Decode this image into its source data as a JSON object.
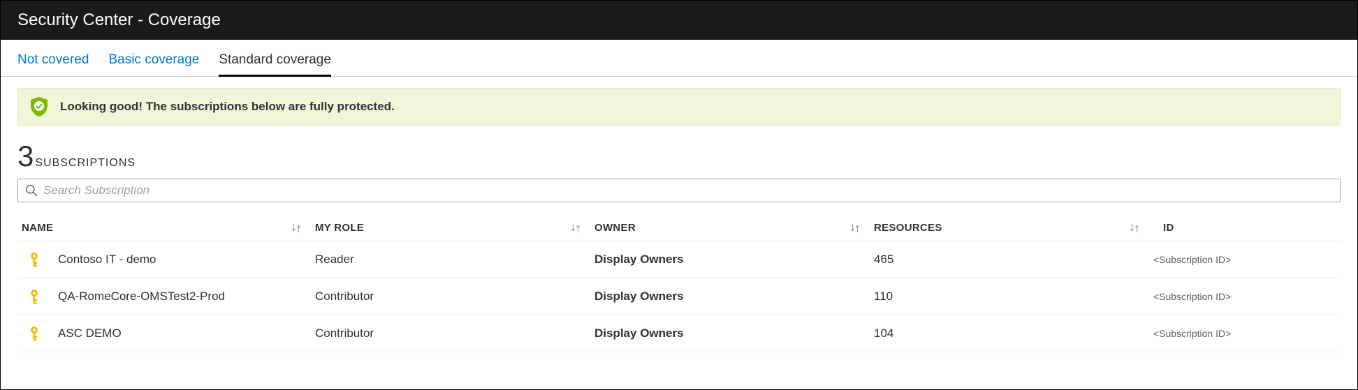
{
  "header": {
    "title": "Security Center - Coverage"
  },
  "tabs": [
    {
      "label": "Not covered",
      "active": false
    },
    {
      "label": "Basic coverage",
      "active": false
    },
    {
      "label": "Standard coverage",
      "active": true
    }
  ],
  "banner": {
    "text": "Looking good! The subscriptions below are fully protected."
  },
  "count": {
    "value": "3",
    "label": "SUBSCRIPTIONS"
  },
  "search": {
    "placeholder": "Search Subscription"
  },
  "columns": {
    "name": "NAME",
    "role": "MY ROLE",
    "owner": "OWNER",
    "resources": "RESOURCES",
    "id": "ID"
  },
  "rows": [
    {
      "name": "Contoso IT - demo",
      "role": "Reader",
      "owner": "Display Owners",
      "resources": "465",
      "id": "<Subscription ID>"
    },
    {
      "name": "QA-RomeCore-OMSTest2-Prod",
      "role": "Contributor",
      "owner": "Display Owners",
      "resources": "110",
      "id": "<Subscription ID>"
    },
    {
      "name": "ASC DEMO",
      "role": "Contributor",
      "owner": "Display Owners",
      "resources": "104",
      "id": "<Subscription ID>"
    }
  ]
}
